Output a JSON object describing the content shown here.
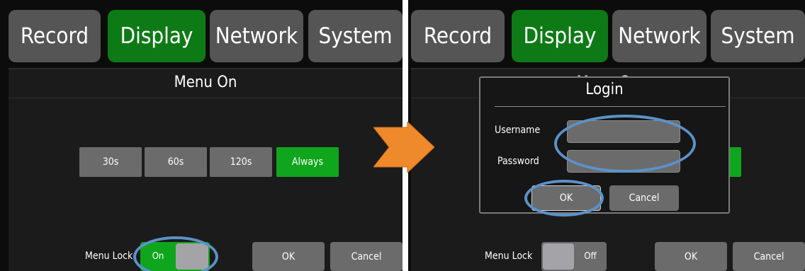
{
  "left": {
    "tabs": [
      {
        "label": "Record",
        "active": false
      },
      {
        "label": "Display",
        "active": true
      },
      {
        "label": "Network",
        "active": false
      },
      {
        "label": "System",
        "active": false
      }
    ],
    "panel_title": "Menu On",
    "durations": [
      {
        "label": "30s",
        "selected": false
      },
      {
        "label": "60s",
        "selected": false
      },
      {
        "label": "120s",
        "selected": false
      },
      {
        "label": "Always",
        "selected": true
      }
    ],
    "menu_lock": {
      "label": "Menu Lock",
      "state": "On"
    },
    "ok_label": "OK",
    "cancel_label": "Cancel"
  },
  "right": {
    "tabs": [
      {
        "label": "Record",
        "active": false
      },
      {
        "label": "Display",
        "active": true
      },
      {
        "label": "Network",
        "active": false
      },
      {
        "label": "System",
        "active": false
      }
    ],
    "panel_title_partial": "Menu On",
    "login": {
      "title": "Login",
      "username_label": "Username",
      "password_label": "Password",
      "username_value": "",
      "password_value": "",
      "ok_label": "OK",
      "cancel_label": "Cancel"
    },
    "menu_lock": {
      "label": "Menu Lock",
      "state": "Off"
    },
    "ok_label": "OK",
    "cancel_label": "Cancel"
  },
  "colors": {
    "active_green": "#0e7a16",
    "selected_green": "#0fa51d",
    "tab_gray": "#555555",
    "button_gray": "#6b6b6b",
    "highlight_ring": "#5b92c8",
    "arrow_orange": "#ef8a2c"
  },
  "icons": {
    "transition": "right-arrow-icon"
  }
}
